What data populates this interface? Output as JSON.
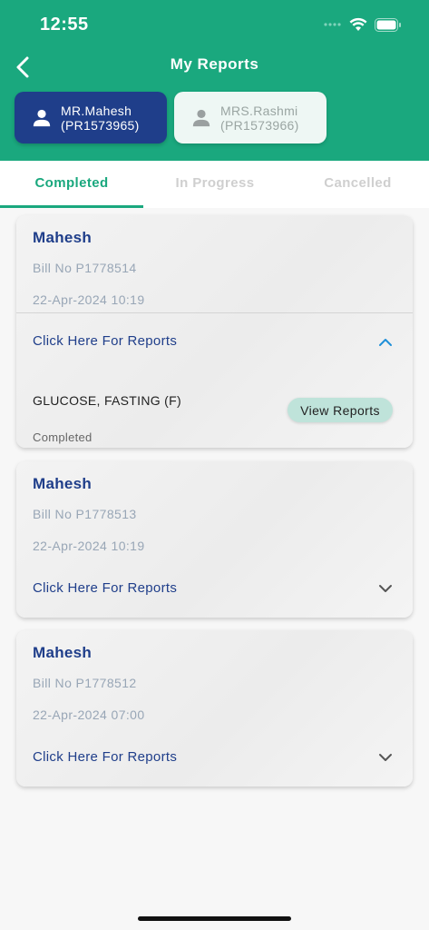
{
  "status_bar": {
    "time": "12:55"
  },
  "nav": {
    "title": "My Reports"
  },
  "patients": [
    {
      "name": "MR.Mahesh",
      "id": "(PR1573965)",
      "active": true
    },
    {
      "name": "MRS.Rashmi",
      "id": "(PR1573966)",
      "active": false
    }
  ],
  "tabs": [
    {
      "label": "Completed",
      "active": true
    },
    {
      "label": "In Progress",
      "active": false
    },
    {
      "label": "Cancelled",
      "active": false
    }
  ],
  "reports": [
    {
      "name": "Mahesh",
      "bill": "Bill No P1778514",
      "date": "22-Apr-2024 10:19",
      "link": "Click Here For Reports",
      "expanded": true,
      "tests": [
        {
          "name": "GLUCOSE, FASTING (F)",
          "status": "Completed",
          "action": "View Reports"
        }
      ]
    },
    {
      "name": "Mahesh",
      "bill": "Bill No P1778513",
      "date": "22-Apr-2024 10:19",
      "link": "Click Here For Reports",
      "expanded": false
    },
    {
      "name": "Mahesh",
      "bill": "Bill No P1778512",
      "date": "22-Apr-2024 07:00",
      "link": "Click Here For Reports",
      "expanded": false
    }
  ],
  "colors": {
    "primary": "#1aa87e",
    "navy": "#1f3e8a",
    "inactive_tab": "#cfcfcf",
    "pill": "#bfe3da"
  },
  "icons": [
    "chevron-left-icon",
    "cellular-signal-icon",
    "wifi-icon",
    "battery-icon",
    "person-icon",
    "chevron-up-icon",
    "chevron-down-icon"
  ]
}
